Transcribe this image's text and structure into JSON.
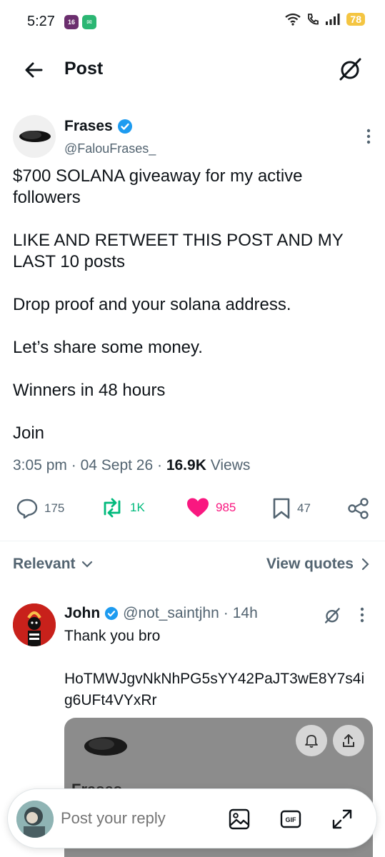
{
  "status_bar": {
    "time": "5:27",
    "battery": "78",
    "app_icon_1": "16"
  },
  "header": {
    "title": "Post"
  },
  "post": {
    "author_name": "Frases",
    "author_handle": "@FalouFrases_",
    "text": "$700 SOLANA giveaway for my active followers\n\nLIKE AND RETWEET THIS POST AND MY LAST 10 posts\n\nDrop proof and your solana address.\n\nLet’s share some money.\n\nWinners in 48 hours\n\nJoin",
    "time": "3:05 pm",
    "date": "04 Sept 26",
    "views_count": "16.9K",
    "views_label": "Views",
    "replies": "175",
    "reposts": "1K",
    "likes": "985",
    "bookmarks": "47"
  },
  "sort": {
    "relevant_label": "Relevant",
    "view_quotes_label": "View quotes"
  },
  "reply": {
    "name": "John",
    "handle": "@not_saintjhn",
    "age": "14h",
    "text": "Thank you bro\n\nHoTMWJgvNkNhPG5sYY42PaJT3wE8Y7s4ig6UFt4VYxRr"
  },
  "embed": {
    "name": "Frases"
  },
  "composer": {
    "placeholder": "Post your reply",
    "gif_label": "GIF"
  },
  "colors": {
    "verified": "#1d9bf0",
    "repost": "#00ba7c",
    "like": "#f91880",
    "muted": "#536471"
  }
}
